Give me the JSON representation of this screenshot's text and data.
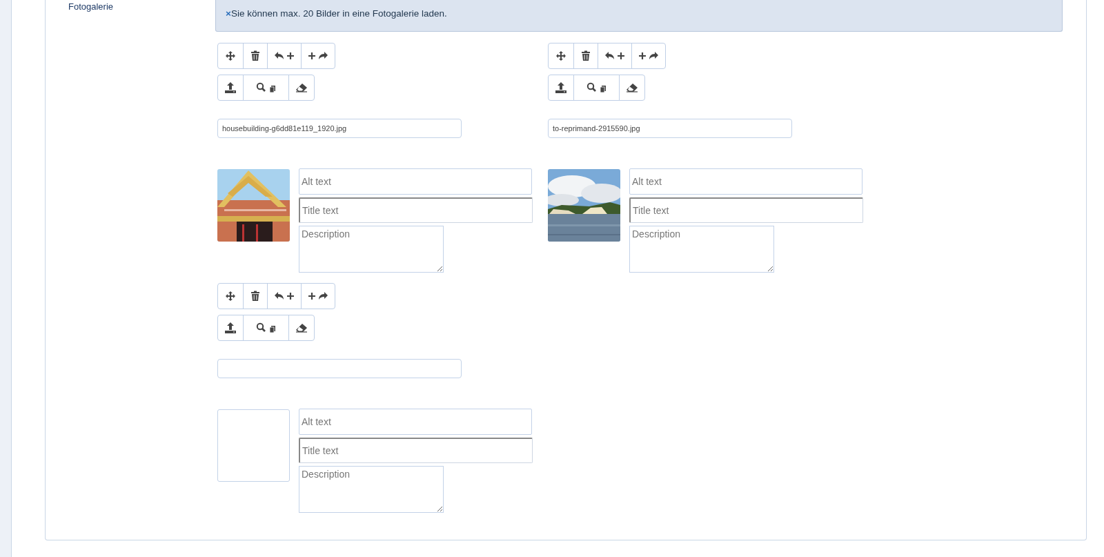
{
  "section_label": "Fotogalerie",
  "alert": {
    "close": "×",
    "message": "Sie können max. 20 Bilder in eine Fotogalerie laden."
  },
  "items": [
    {
      "filename": "housebuilding-g6dd81e119_1920.jpg",
      "alt_placeholder": "Alt text",
      "title_placeholder": "Title text",
      "description_placeholder": "Description"
    },
    {
      "filename": "to-reprimand-2915590.jpg",
      "alt_placeholder": "Alt text",
      "title_placeholder": "Title text",
      "description_placeholder": "Description"
    },
    {
      "alt_placeholder": "Alt text",
      "title_placeholder": "Title text",
      "description_placeholder": "Description"
    }
  ]
}
